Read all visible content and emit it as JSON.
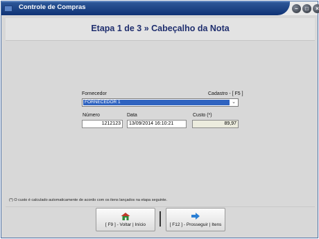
{
  "window": {
    "title": "Controle de Compras"
  },
  "header": {
    "title": "Etapa 1 de 3 » Cabeçalho da Nota"
  },
  "form": {
    "fornecedor_label": "Fornecedor",
    "cadastro_label": "Cadastro - [ F5 ]",
    "fornecedor_value": "FORNECEDOR 1",
    "numero_label": "Número",
    "numero_value": "1212123",
    "data_label": "Data",
    "data_value": "13/09/2014 16:10:21",
    "custo_label": "Custo (*)",
    "custo_value": "89,97"
  },
  "footnote": "(*) O custo é calculado automaticamente de acordo com os itens lançados na etapa seguinte.",
  "buttons": {
    "back_label": "[ F9 ] - Voltar | Início",
    "next_label": "[ F12 ] - Prosseguir | Itens"
  }
}
